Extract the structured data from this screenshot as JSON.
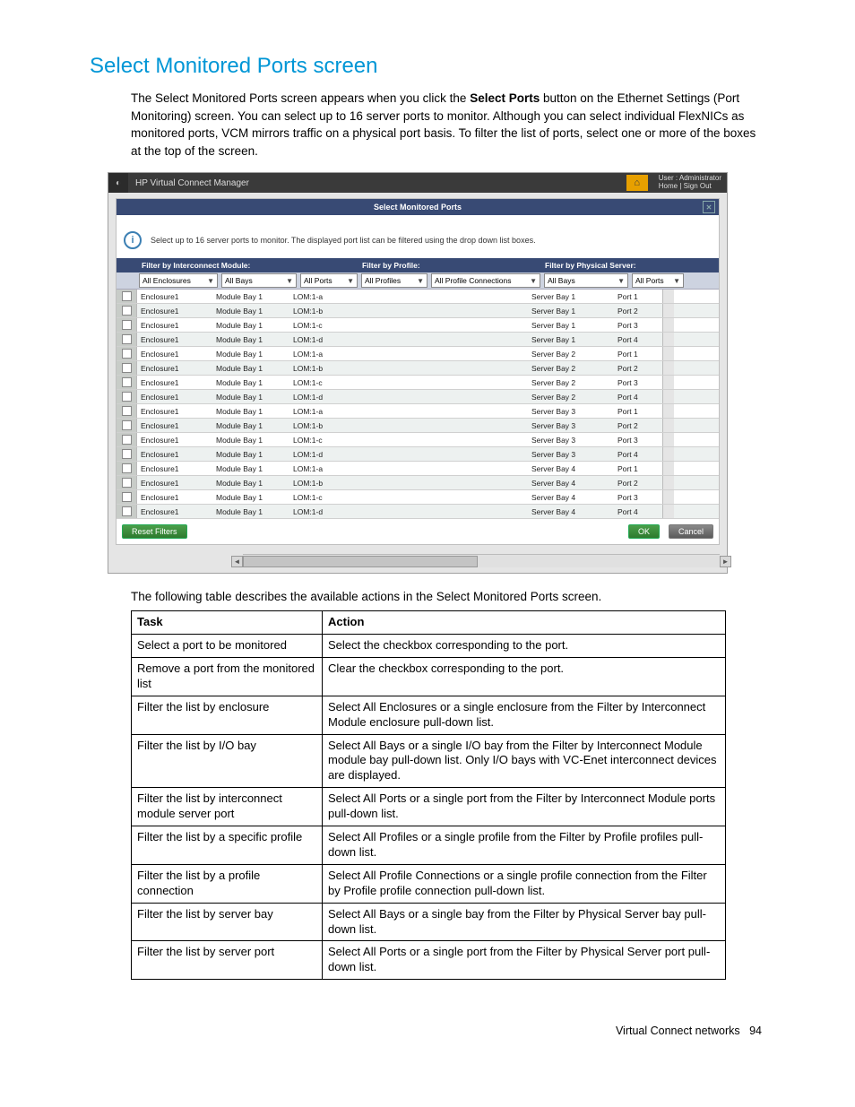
{
  "page": {
    "heading": "Select Monitored Ports screen",
    "intro_pre": "The Select Monitored Ports screen appears when you click the ",
    "intro_bold": "Select Ports",
    "intro_post": " button on the Ethernet Settings (Port Monitoring) screen. You can select up to 16 server ports to monitor. Although you can select individual FlexNICs as monitored ports, VCM mirrors traffic on a physical port basis. To filter the list of ports, select one or more of the boxes at the top of the screen.",
    "after_shot": "The following table describes the available actions in the Select Monitored Ports screen.",
    "footer_label": "Virtual Connect networks",
    "footer_page": "94"
  },
  "app": {
    "title": "HP Virtual Connect Manager",
    "user": "User : Administrator",
    "home": "Home",
    "signout": "Sign Out",
    "tab": "Select Monitored Ports",
    "hint": "Select up to 16 server ports to monitor. The displayed port list can be filtered using the drop down list boxes.",
    "filter_groups": {
      "im": "Filter by Interconnect Module:",
      "pr": "Filter by Profile:",
      "ps": "Filter by Physical Server:"
    },
    "selects": {
      "enc": "All Enclosures",
      "bay": "All Bays",
      "port": "All Ports",
      "prof": "All Profiles",
      "conn": "All Profile Connections",
      "sbay": "All Bays",
      "sport": "All Ports"
    },
    "buttons": {
      "reset": "Reset Filters",
      "ok": "OK",
      "cancel": "Cancel"
    },
    "rows": [
      {
        "enc": "Enclosure1",
        "bay": "Module Bay 1",
        "port": "LOM:1-a",
        "sbay": "Server Bay 1",
        "sport": "Port 1"
      },
      {
        "enc": "Enclosure1",
        "bay": "Module Bay 1",
        "port": "LOM:1-b",
        "sbay": "Server Bay 1",
        "sport": "Port 2"
      },
      {
        "enc": "Enclosure1",
        "bay": "Module Bay 1",
        "port": "LOM:1-c",
        "sbay": "Server Bay 1",
        "sport": "Port 3"
      },
      {
        "enc": "Enclosure1",
        "bay": "Module Bay 1",
        "port": "LOM:1-d",
        "sbay": "Server Bay 1",
        "sport": "Port 4"
      },
      {
        "enc": "Enclosure1",
        "bay": "Module Bay 1",
        "port": "LOM:1-a",
        "sbay": "Server Bay 2",
        "sport": "Port 1"
      },
      {
        "enc": "Enclosure1",
        "bay": "Module Bay 1",
        "port": "LOM:1-b",
        "sbay": "Server Bay 2",
        "sport": "Port 2"
      },
      {
        "enc": "Enclosure1",
        "bay": "Module Bay 1",
        "port": "LOM:1-c",
        "sbay": "Server Bay 2",
        "sport": "Port 3"
      },
      {
        "enc": "Enclosure1",
        "bay": "Module Bay 1",
        "port": "LOM:1-d",
        "sbay": "Server Bay 2",
        "sport": "Port 4"
      },
      {
        "enc": "Enclosure1",
        "bay": "Module Bay 1",
        "port": "LOM:1-a",
        "sbay": "Server Bay 3",
        "sport": "Port 1"
      },
      {
        "enc": "Enclosure1",
        "bay": "Module Bay 1",
        "port": "LOM:1-b",
        "sbay": "Server Bay 3",
        "sport": "Port 2"
      },
      {
        "enc": "Enclosure1",
        "bay": "Module Bay 1",
        "port": "LOM:1-c",
        "sbay": "Server Bay 3",
        "sport": "Port 3"
      },
      {
        "enc": "Enclosure1",
        "bay": "Module Bay 1",
        "port": "LOM:1-d",
        "sbay": "Server Bay 3",
        "sport": "Port 4"
      },
      {
        "enc": "Enclosure1",
        "bay": "Module Bay 1",
        "port": "LOM:1-a",
        "sbay": "Server Bay 4",
        "sport": "Port 1"
      },
      {
        "enc": "Enclosure1",
        "bay": "Module Bay 1",
        "port": "LOM:1-b",
        "sbay": "Server Bay 4",
        "sport": "Port 2"
      },
      {
        "enc": "Enclosure1",
        "bay": "Module Bay 1",
        "port": "LOM:1-c",
        "sbay": "Server Bay 4",
        "sport": "Port 3"
      },
      {
        "enc": "Enclosure1",
        "bay": "Module Bay 1",
        "port": "LOM:1-d",
        "sbay": "Server Bay 4",
        "sport": "Port 4"
      }
    ]
  },
  "table": {
    "head_task": "Task",
    "head_action": "Action",
    "rows": [
      {
        "task": "Select a port to be monitored",
        "action": "Select the checkbox corresponding to the port."
      },
      {
        "task": "Remove a port from the monitored list",
        "action": "Clear the checkbox corresponding to the port."
      },
      {
        "task": "Filter the list by enclosure",
        "action": "Select All Enclosures or a single   enclosure from the Filter by Interconnect Module enclosure pull-down list."
      },
      {
        "task": "Filter the list by I/O bay",
        "action": "Select All Bays or a single I/O bay from the Filter by Interconnect Module module bay pull-down list. Only I/O bays with VC-Enet interconnect devices are displayed."
      },
      {
        "task": "Filter the list by interconnect module server port",
        "action": "Select All Ports or a single port from the Filter by Interconnect Module ports pull-down list."
      },
      {
        "task": "Filter the list by a specific profile",
        "action": "Select All Profiles or a single profile from the Filter by Profile profiles pull-down list."
      },
      {
        "task": "Filter the list by a profile connection",
        "action": "Select All Profile Connections or a single profile connection from the Filter by Profile profile connection pull-down list."
      },
      {
        "task": "Filter the list by server bay",
        "action": "Select All Bays or a single bay from the Filter by Physical Server bay pull-down list."
      },
      {
        "task": "Filter the list by server port",
        "action": "Select All Ports or a single port from the Filter by Physical Server port pull-down list."
      }
    ]
  }
}
